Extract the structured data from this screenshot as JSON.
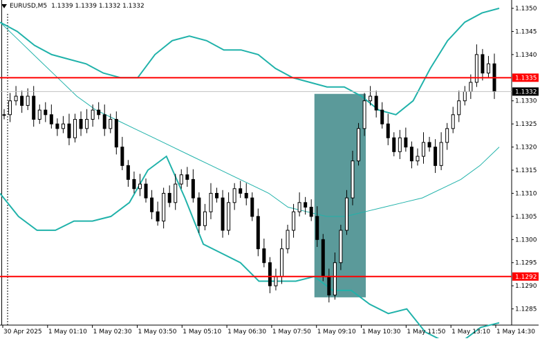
{
  "header": {
    "symbol": "EURUSD,M5",
    "ohlc": "1.1339 1.1339 1.1332 1.1332"
  },
  "colors": {
    "background": "#ffffff",
    "candle": "#000000",
    "bollinger": "#20b2aa",
    "level": "#ff0000",
    "highlight": "#5b9a9a"
  },
  "price_axis": {
    "ticks": [
      "1.1350",
      "1.1345",
      "1.1340",
      "1.1330",
      "1.1325",
      "1.1320",
      "1.1315",
      "1.1310",
      "1.1305",
      "1.1300",
      "1.1295",
      "1.1290",
      "1.1285"
    ],
    "current_price": "1.1332",
    "resistance_label": "1.1335",
    "support_label": "1.1292"
  },
  "chart_data": {
    "type": "candlestick",
    "symbol": "EURUSD",
    "timeframe": "M5",
    "ylim": [
      1.12815,
      1.13515
    ],
    "x_tick_labels": [
      "30 Apr 2025",
      "1 May 01:10",
      "1 May 02:30",
      "1 May 03:50",
      "1 May 05:10",
      "1 May 06:30",
      "1 May 07:50",
      "1 May 09:10",
      "1 May 10:30",
      "1 May 11:50",
      "1 May 13:10",
      "1 May 14:30"
    ],
    "horizontal_levels": [
      1.1335,
      1.1292
    ],
    "highlight_zone": {
      "from_price": 1.12875,
      "to_price": 1.13315
    },
    "close_path": [
      1.1327,
      1.133,
      1.1331,
      1.1329,
      1.1331,
      1.1326,
      1.1328,
      1.1327,
      1.1325,
      1.1324,
      1.1325,
      1.1322,
      1.1326,
      1.1324,
      1.1326,
      1.1328,
      1.1327,
      1.1324,
      1.1326,
      1.132,
      1.1316,
      1.1313,
      1.1311,
      1.1312,
      1.1309,
      1.1306,
      1.1304,
      1.131,
      1.1308,
      1.1312,
      1.1314,
      1.1313,
      1.1309,
      1.1303,
      1.1306,
      1.131,
      1.1309,
      1.1302,
      1.1308,
      1.1311,
      1.131,
      1.1309,
      1.1305,
      1.1298,
      1.1295,
      1.129,
      1.1292,
      1.1298,
      1.1302,
      1.1306,
      1.1308,
      1.1307,
      1.1305,
      1.13,
      1.1292,
      1.1288,
      1.1295,
      1.1302,
      1.1309,
      1.1317,
      1.1324,
      1.133,
      1.1331,
      1.1328,
      1.1325,
      1.1322,
      1.1319,
      1.1322,
      1.132,
      1.1317,
      1.1318,
      1.1321,
      1.132,
      1.1316,
      1.1321,
      1.1324,
      1.1327,
      1.133,
      1.1332,
      1.1334,
      1.134,
      1.1336,
      1.1338,
      1.1332
    ],
    "bb_upper": [
      1.1347,
      1.1345,
      1.1342,
      1.134,
      1.1339,
      1.1338,
      1.1336,
      1.1335,
      1.1335,
      1.134,
      1.1343,
      1.1344,
      1.1343,
      1.1341,
      1.1341,
      1.134,
      1.1337,
      1.1335,
      1.1334,
      1.1333,
      1.1333,
      1.1331,
      1.1328,
      1.1327,
      1.133,
      1.1337,
      1.1343,
      1.1347,
      1.1349,
      1.135
    ],
    "bb_middle": [
      1.1347,
      1.1343,
      1.1339,
      1.1335,
      1.1331,
      1.1328,
      1.1326,
      1.1324,
      1.1322,
      1.132,
      1.1318,
      1.1316,
      1.1314,
      1.1312,
      1.131,
      1.1307,
      1.1306,
      1.1305,
      1.1305,
      1.1306,
      1.1307,
      1.1308,
      1.1309,
      1.1311,
      1.1313,
      1.1316,
      1.132
    ],
    "bb_lower": [
      1.131,
      1.1305,
      1.1302,
      1.1302,
      1.1304,
      1.1304,
      1.1305,
      1.1308,
      1.1315,
      1.1318,
      1.1309,
      1.1299,
      1.1297,
      1.1295,
      1.1291,
      1.1291,
      1.1291,
      1.1292,
      1.1289,
      1.1289,
      1.1286,
      1.1284,
      1.1285,
      1.128,
      1.1278,
      1.1278,
      1.1281,
      1.1282
    ]
  }
}
